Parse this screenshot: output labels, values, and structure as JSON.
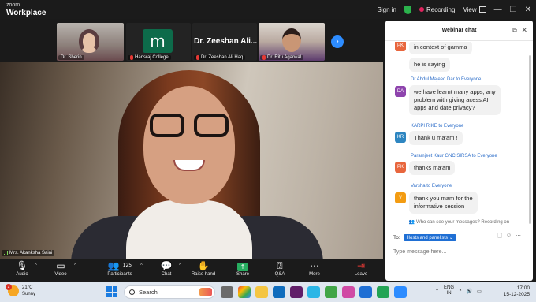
{
  "app": {
    "brand_line1": "zoom",
    "brand_line2": "Workplace",
    "signin": "Sign in",
    "recording": "Recording",
    "view": "View",
    "win_controls": [
      "—",
      "❐",
      "✕"
    ]
  },
  "thumbnails": [
    {
      "name": "Dr. Sherin"
    },
    {
      "name": "Hansraj College",
      "logo": "m"
    },
    {
      "name": "Dr. Zeeshan Ali Haq",
      "big_label": "Dr. Zeeshan Ali..."
    },
    {
      "name": "Dr. Ritu Agarwal"
    }
  ],
  "main_speaker": {
    "name": "Mrs. Akanksha Saini"
  },
  "toolbar": {
    "audio": "Audio",
    "video": "Video",
    "participants": "Participants",
    "participants_count": "125",
    "chat": "Chat",
    "raise_hand": "Raise hand",
    "share": "Share",
    "qa": "Q&A",
    "more": "More",
    "leave": "Leave"
  },
  "chat": {
    "title": "Webinar chat",
    "messages": [
      {
        "sender": "",
        "initials": "PK",
        "color": "#e8663d",
        "text": "in context of gamma"
      },
      {
        "sender": "",
        "initials": "",
        "color": "",
        "text": "he is saying"
      },
      {
        "sender": "Dr Abdul Majeed Dar to Everyone",
        "initials": "DA",
        "color": "#8e44ad",
        "text_lines": [
          "we have learnt many apps, any",
          "problem with giving acess AI",
          "apps and date privacy?"
        ]
      },
      {
        "sender": "KARPI RIKE to Everyone",
        "initials": "KR",
        "color": "#2e86c1",
        "text": "Thank u ma'am !"
      },
      {
        "sender": "Paramjeet Kaur GNC SIRSA to Everyone",
        "initials": "PK",
        "color": "#e8663d",
        "text": "thanks ma'am"
      },
      {
        "sender": "Varsha to Everyone",
        "initials": "V",
        "color": "#f39c12",
        "text_lines": [
          "thank you mam for the",
          "informative session"
        ]
      }
    ],
    "privacy_note": "Who can see your messages? Recording on",
    "to_label": "To:",
    "to_value": "Hosts and panelists ⌄",
    "input_placeholder": "Type message here..."
  },
  "taskbar": {
    "weather_temp": "21°C",
    "weather_desc": "Sunny",
    "weather_badge": "2",
    "search_placeholder": "Search",
    "lang_1": "ENG",
    "lang_2": "IN",
    "time": "17:00",
    "date": "15-12-2025"
  }
}
